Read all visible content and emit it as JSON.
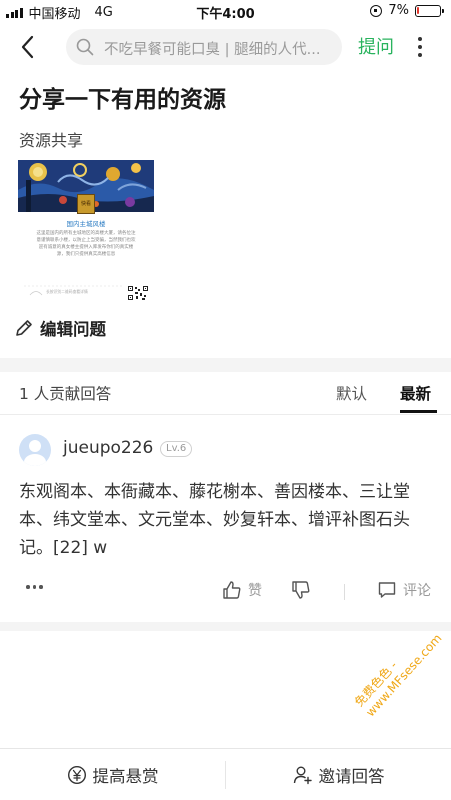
{
  "status_bar": {
    "carrier": "中国移动",
    "network": "4G",
    "time": "下午4:00",
    "battery": "7%",
    "battery_level": 0.07
  },
  "nav": {
    "search_placeholder": "不吃早餐可能口臭 | 腿细的人代...",
    "ask_label": "提问"
  },
  "question": {
    "title": "分享一下有用的资源",
    "description": "资源共享",
    "image": {
      "badge_text": "快看",
      "title": "国内主城风楼",
      "text": "这里是国内的所有主城地区的高楼大厦，请各位注意谨慎联系小楼，以防止上当受骗，当然我们也欢迎有诚意的真女楼主提供入库发布你们的真实楼源，我们只提供真实高楼信息",
      "footer_text": "长按识别二维码查看详情"
    },
    "edit_label": "编辑问题"
  },
  "answers_header": {
    "count_label": "1 人贡献回答",
    "sort_default": "默认",
    "sort_latest": "最新"
  },
  "answer": {
    "username": "jueupo226",
    "level": "Lv.6",
    "text": "东观阁本、本衙藏本、藤花榭本、善因楼本、三让堂本、纬文堂本、文元堂本、妙复轩本、增评补图石头记。[22] w",
    "like_label": "赞",
    "comment_label": "评论"
  },
  "toolbar": {
    "reward_label": "提高悬赏",
    "invite_label": "邀请回答"
  },
  "watermark": {
    "line1": "免费色色 -",
    "line2": "www.MFsese.com"
  },
  "colors": {
    "accent": "#29b35e",
    "battery_low": "#e2362b",
    "link_blue": "#2e7ec4",
    "watermark": "#f0a818"
  }
}
